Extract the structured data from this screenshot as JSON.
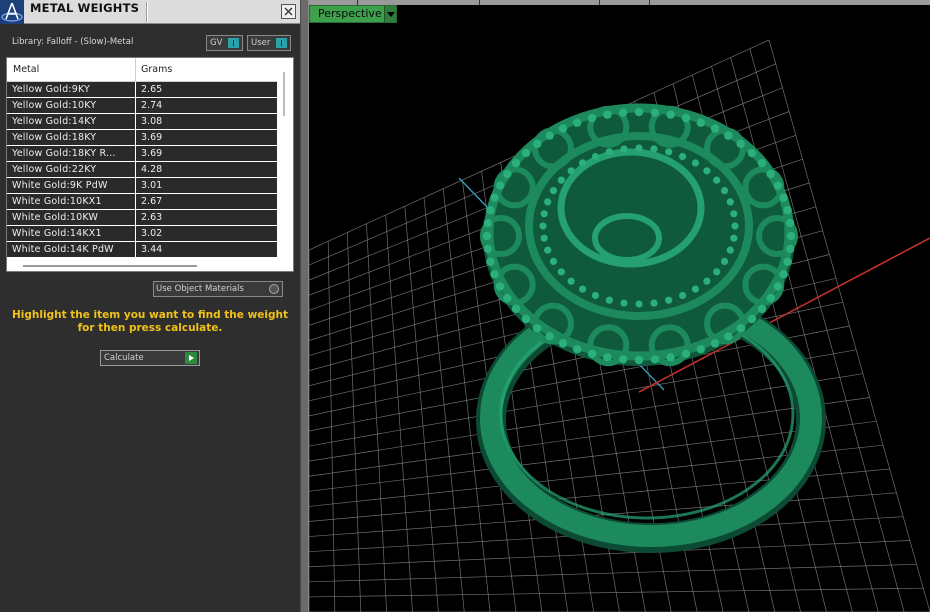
{
  "panel": {
    "title": "METAL WEIGHTS",
    "library_label": "Library: Falloff - (Slow)-Metal",
    "gv_label": "GV",
    "user_label": "User",
    "table": {
      "headers": [
        "Metal",
        "Grams"
      ],
      "rows": [
        {
          "metal": "Yellow Gold:9KY",
          "grams": "2.65"
        },
        {
          "metal": "Yellow Gold:10KY",
          "grams": "2.74"
        },
        {
          "metal": "Yellow Gold:14KY",
          "grams": "3.08"
        },
        {
          "metal": "Yellow Gold:18KY",
          "grams": "3.69"
        },
        {
          "metal": "Yellow Gold:18KY R...",
          "grams": "3.69"
        },
        {
          "metal": "Yellow Gold:22KY",
          "grams": "4.28"
        },
        {
          "metal": "White Gold:9K PdW",
          "grams": "3.01"
        },
        {
          "metal": "White Gold:10KX1",
          "grams": "2.67"
        },
        {
          "metal": "White Gold:10KW",
          "grams": "2.63"
        },
        {
          "metal": "White Gold:14KX1",
          "grams": "3.02"
        },
        {
          "metal": "White Gold:14K PdW",
          "grams": "3.44"
        }
      ]
    },
    "use_object_materials": "Use Object Materials",
    "hint": "Highlight the item you want to find the weight for then press calculate.",
    "calculate": "Calculate"
  },
  "viewport": {
    "view_mode": "Perspective"
  },
  "colors": {
    "hint_text": "#f0c21a",
    "model": "#1d8a5e",
    "viewport_tab": "#3ca14a",
    "grid": "#8a8a8a"
  },
  "icons": {
    "app": "rhino-logo-icon",
    "close": "close-icon",
    "dropdown": "chevron-down-icon"
  }
}
